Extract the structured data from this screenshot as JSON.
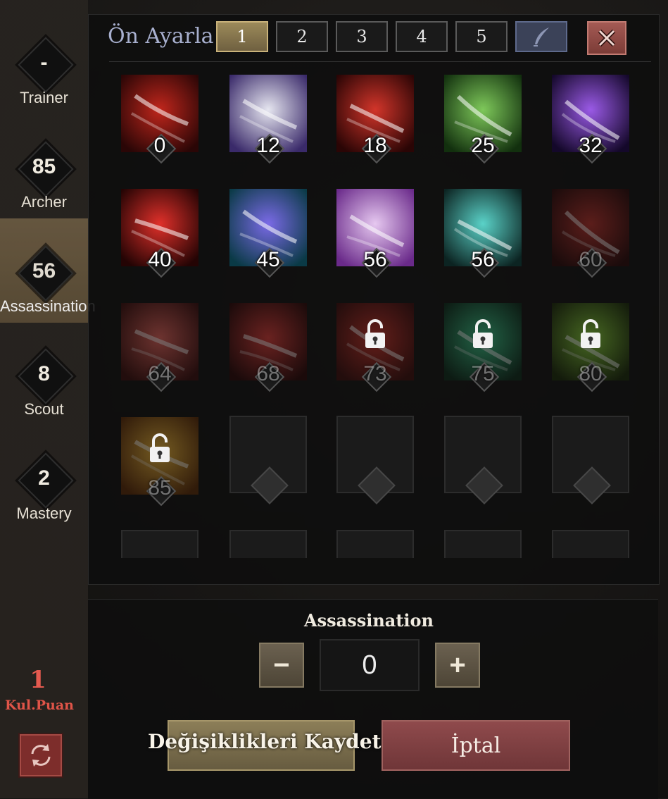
{
  "sidebar": {
    "trees": [
      {
        "level": "-",
        "label": "Trainer",
        "active": false
      },
      {
        "level": "85",
        "label": "Archer",
        "active": false
      },
      {
        "level": "56",
        "label": "Assassination",
        "active": true
      },
      {
        "level": "8",
        "label": "Scout",
        "active": false
      },
      {
        "level": "2",
        "label": "Mastery",
        "active": false
      }
    ],
    "points_value": "1",
    "points_label": "Kul.Puan",
    "reset_icon": "refresh-icon"
  },
  "presets": {
    "label": "Ön Ayarla",
    "buttons": [
      "1",
      "2",
      "3",
      "4",
      "5"
    ],
    "active": "1",
    "edit_icon": "quill-icon",
    "close_icon": "close-icon"
  },
  "skills": [
    {
      "level": "0",
      "colors": [
        "#c0261c",
        "#2a0606"
      ],
      "locked": false,
      "dim": false
    },
    {
      "level": "12",
      "colors": [
        "#e6e6f0",
        "#3a2a6a"
      ],
      "locked": false,
      "dim": false
    },
    {
      "level": "18",
      "colors": [
        "#d2352a",
        "#2a0505"
      ],
      "locked": false,
      "dim": false
    },
    {
      "level": "25",
      "colors": [
        "#7ec85a",
        "#12300e"
      ],
      "locked": false,
      "dim": false
    },
    {
      "level": "32",
      "colors": [
        "#9a5ae6",
        "#14082a"
      ],
      "locked": false,
      "dim": false
    },
    {
      "level": "40",
      "colors": [
        "#e0302a",
        "#240404"
      ],
      "locked": false,
      "dim": false
    },
    {
      "level": "45",
      "colors": [
        "#7a6ae6",
        "#0a3a46"
      ],
      "locked": false,
      "dim": false
    },
    {
      "level": "56",
      "colors": [
        "#e6c8f0",
        "#6a2a8a"
      ],
      "locked": false,
      "dim": false
    },
    {
      "level": "56",
      "colors": [
        "#5ad2c8",
        "#0c2422"
      ],
      "locked": false,
      "dim": false
    },
    {
      "level": "60",
      "colors": [
        "#b8302a",
        "#2a0808"
      ],
      "locked": false,
      "dim": true
    },
    {
      "level": "64",
      "colors": [
        "#e06058",
        "#3a0c0c"
      ],
      "locked": false,
      "dim": true
    },
    {
      "level": "68",
      "colors": [
        "#d83a36",
        "#2a0606"
      ],
      "locked": false,
      "dim": true
    },
    {
      "level": "73",
      "colors": [
        "#c83028",
        "#3a0a0a"
      ],
      "locked": true,
      "dim": true
    },
    {
      "level": "75",
      "colors": [
        "#3ac88a",
        "#0a2a1a"
      ],
      "locked": true,
      "dim": true
    },
    {
      "level": "80",
      "colors": [
        "#8ad23a",
        "#1a2a08"
      ],
      "locked": true,
      "dim": true
    },
    {
      "level": "85",
      "colors": [
        "#f0b83a",
        "#5a2a06"
      ],
      "locked": true,
      "dim": true
    }
  ],
  "empty_slots": 4,
  "partial_slots": 5,
  "editor": {
    "title": "Assassination",
    "minus": "−",
    "value": "0",
    "plus": "+"
  },
  "actions": {
    "save": "Değişiklikleri Kaydet",
    "cancel": "İptal"
  }
}
